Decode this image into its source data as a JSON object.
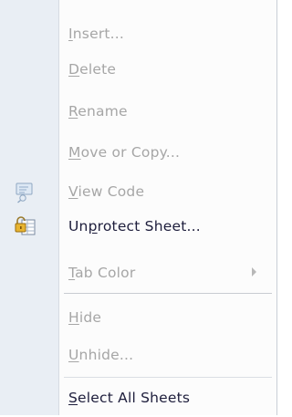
{
  "menu": {
    "items": [
      {
        "pre": "",
        "key": "I",
        "post": "nsert...",
        "enabled": false
      },
      {
        "pre": "",
        "key": "D",
        "post": "elete",
        "enabled": false
      },
      {
        "pre": "",
        "key": "R",
        "post": "ename",
        "enabled": false
      },
      {
        "pre": "",
        "key": "M",
        "post": "ove or Copy...",
        "enabled": false
      },
      {
        "pre": "",
        "key": "V",
        "post": "iew Code",
        "enabled": false,
        "icon": "view-code-icon"
      },
      {
        "pre": "Un",
        "key": "p",
        "post": "rotect Sheet...",
        "enabled": true,
        "icon": "unprotect-sheet-icon"
      },
      {
        "pre": "",
        "key": "T",
        "post": "ab Color",
        "enabled": false,
        "submenu": true
      },
      {
        "pre": "",
        "key": "H",
        "post": "ide",
        "enabled": false
      },
      {
        "pre": "",
        "key": "U",
        "post": "nhide...",
        "enabled": false
      },
      {
        "pre": "",
        "key": "S",
        "post": "elect All Sheets",
        "enabled": true
      }
    ]
  },
  "colors": {
    "disabled_text": "#a6a6a6",
    "enabled_text": "#1e1e3c",
    "gutter": "#e9eef4"
  }
}
